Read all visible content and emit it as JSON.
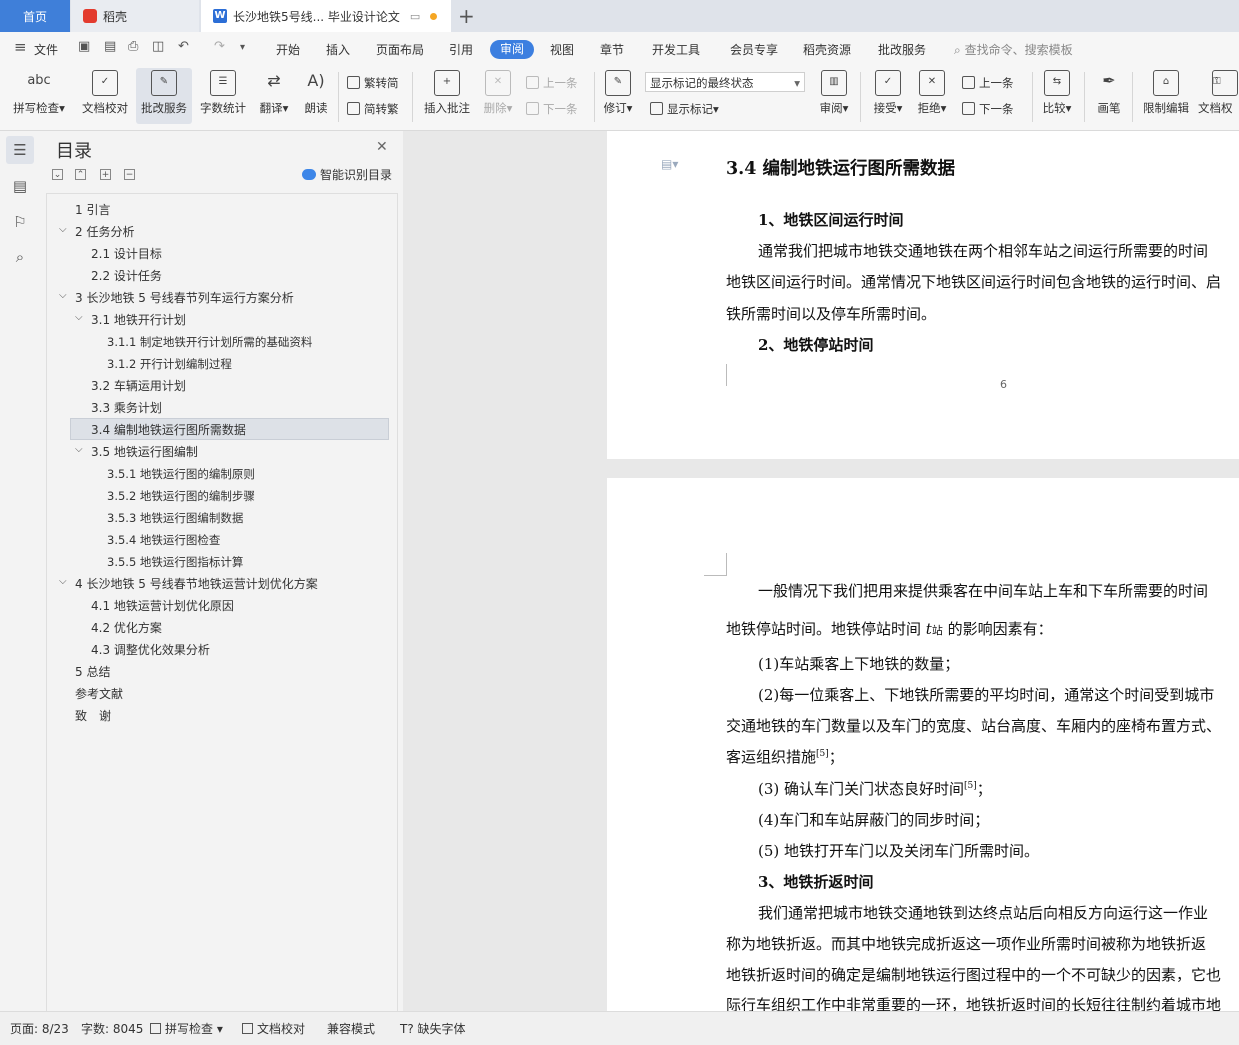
{
  "tabs": {
    "home": "首页",
    "daoke": "稻壳",
    "doc": "长沙地铁5号线... 毕业设计论文"
  },
  "menu": {
    "file": "文件",
    "items": [
      "开始",
      "插入",
      "页面布局",
      "引用",
      "审阅",
      "视图",
      "章节",
      "开发工具",
      "会员专享",
      "稻壳资源",
      "批改服务"
    ],
    "active": "审阅",
    "search": "查找命令、搜索模板"
  },
  "ribbon": {
    "spell": "拼写检查",
    "spell_icon": "abc",
    "proof": "文档校对",
    "correct": "批改服务",
    "wordcount": "字数统计",
    "translate": "翻译",
    "read": "朗读",
    "to_trad": "繁转简",
    "to_simp": "简转繁",
    "insert_comment": "插入批注",
    "delete": "删除",
    "prev": "上一条",
    "next": "下一条",
    "revise": "修订",
    "markup_state": "显示标记的最终状态",
    "show_markup": "显示标记",
    "review": "审阅",
    "accept": "接受",
    "reject": "拒绝",
    "prev2": "上一条",
    "next2": "下一条",
    "compare": "比较",
    "pen": "画笔",
    "restrict": "限制编辑",
    "doc_perm": "文档权"
  },
  "toc": {
    "title": "目录",
    "ai": "智能识别目录",
    "items": [
      {
        "text": "1 引言"
      },
      {
        "text": "2 任务分析"
      },
      {
        "text": "2.1 设计目标"
      },
      {
        "text": "2.2 设计任务"
      },
      {
        "text": "3 长沙地铁 5 号线春节列车运行方案分析"
      },
      {
        "text": "3.1 地铁开行计划"
      },
      {
        "text": "3.1.1 制定地铁开行计划所需的基础资料"
      },
      {
        "text": "3.1.2 开行计划编制过程"
      },
      {
        "text": "3.2 车辆运用计划"
      },
      {
        "text": "3.3 乘务计划"
      },
      {
        "text": "3.4 编制地铁运行图所需数据"
      },
      {
        "text": "3.5 地铁运行图编制"
      },
      {
        "text": "3.5.1 地铁运行图的编制原则"
      },
      {
        "text": "3.5.2 地铁运行图的编制步骤"
      },
      {
        "text": "3.5.3 地铁运行图编制数据"
      },
      {
        "text": "3.5.4 地铁运行图检查"
      },
      {
        "text": "3.5.5 地铁运行图指标计算"
      },
      {
        "text": "4 长沙地铁 5 号线春节地铁运营计划优化方案"
      },
      {
        "text": "4.1 地铁运营计划优化原因"
      },
      {
        "text": "4.2 优化方案"
      },
      {
        "text": "4.3 调整优化效果分析"
      },
      {
        "text": "5 总结"
      },
      {
        "text": "参考文献"
      },
      {
        "text": "致　谢"
      }
    ],
    "selected_index": 10
  },
  "doc": {
    "p1": {
      "heading": "3.4 编制地铁运行图所需数据",
      "sub1": "1、地铁区间运行时间",
      "line1": "通常我们把城市地铁交通地铁在两个相邻车站之间运行所需要的时间",
      "line2": "地铁区间运行时间。通常情况下地铁区间运行时间包含地铁的运行时间、启",
      "line3": "铁所需时间以及停车所需时间。",
      "sub2": "2、地铁停站时间",
      "page_num": "6"
    },
    "p2": {
      "line1": "一般情况下我们把用来提供乘客在中间车站上车和下车所需要的时间",
      "line2_a": "地铁停站时间。地铁停站时间 ",
      "line2_t": "t",
      "line2_sub": "站",
      "line2_b": " 的影响因素有：",
      "item1": "(1)车站乘客上下地铁的数量；",
      "item2": "(2)每一位乘客上、下地铁所需要的平均时间，通常这个时间受到城市",
      "item2b": "交通地铁的车门数量以及车门的宽度、站台高度、车厢内的座椅布置方式、",
      "item2c": "客运组织措施",
      "ref5": "[5]",
      "item2c_end": "；",
      "item3": "(3)  确认车门关门状态良好时间",
      "item3_end": "；",
      "item4": "(4)车门和车站屏蔽门的同步时间；",
      "item5": "(5)  地铁打开车门以及关闭车门所需时间。",
      "sub3": "3、地铁折返时间",
      "line3a": "我们通常把城市地铁交通地铁到达终点站后向相反方向运行这一作业",
      "line3b": "称为地铁折返。而其中地铁完成折返这一项作业所需时间被称为地铁折返",
      "line3c": "地铁折返时间的确定是编制地铁运行图过程中的一个不可缺少的因素，它也",
      "line3d": "际行车组织工作中非常重要的一环，地铁折返时间的长短往往制约着城市地"
    }
  },
  "status": {
    "page": "页面: 8/23",
    "words": "字数: 8045",
    "spell": "拼写检查",
    "proof": "文档校对",
    "compat": "兼容模式",
    "missing_font": "缺失字体"
  }
}
